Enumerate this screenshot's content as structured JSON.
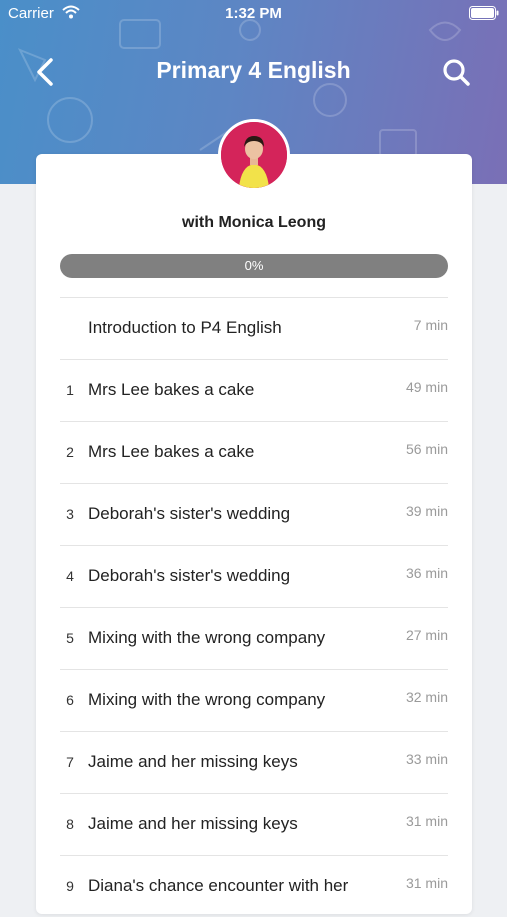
{
  "status_bar": {
    "carrier": "Carrier",
    "time": "1:32 PM"
  },
  "nav": {
    "title": "Primary 4 English",
    "back_icon": "chevron-left-icon",
    "search_icon": "search-icon"
  },
  "course": {
    "instructor_label": "with Monica Leong",
    "progress_text": "0%",
    "progress_value": 0
  },
  "lessons": [
    {
      "num": "",
      "title": "Introduction to P4 English",
      "duration": "7 min"
    },
    {
      "num": "1",
      "title": "Mrs Lee bakes a cake",
      "duration": "49 min"
    },
    {
      "num": "2",
      "title": "Mrs Lee bakes a cake",
      "duration": "56 min"
    },
    {
      "num": "3",
      "title": "Deborah's sister's wedding",
      "duration": "39 min"
    },
    {
      "num": "4",
      "title": "Deborah's sister's wedding",
      "duration": "36 min"
    },
    {
      "num": "5",
      "title": "Mixing with the wrong company",
      "duration": "27 min"
    },
    {
      "num": "6",
      "title": "Mixing with the wrong company",
      "duration": "32 min"
    },
    {
      "num": "7",
      "title": "Jaime and her missing keys",
      "duration": "33 min"
    },
    {
      "num": "8",
      "title": "Jaime and her missing keys",
      "duration": "31 min"
    },
    {
      "num": "9",
      "title": "Diana's chance encounter with her",
      "duration": "31 min"
    }
  ],
  "colors": {
    "header_start": "#4a8fc9",
    "header_end": "#7a6fb6",
    "progress_track": "#808080",
    "avatar_bg": "#d4245a"
  }
}
